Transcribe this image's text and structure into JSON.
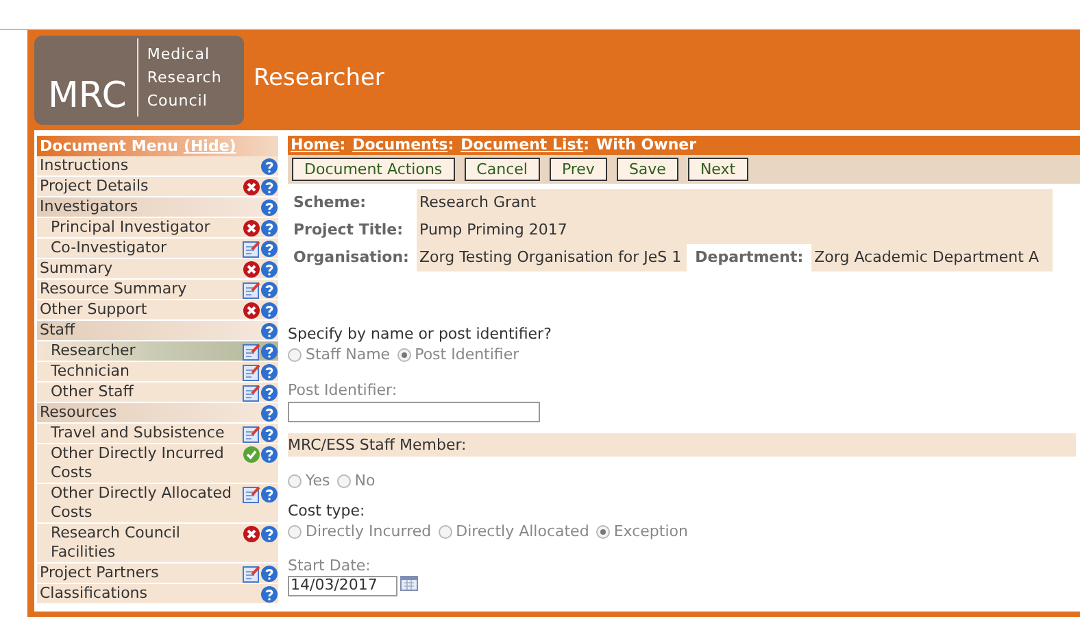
{
  "header": {
    "logo": {
      "mark": "MRC",
      "lines": [
        "Medical",
        "Research",
        "Council"
      ]
    },
    "title": "Researcher"
  },
  "menu": {
    "title": "Document Menu",
    "hide_link": "(Hide)",
    "items": [
      {
        "label": "Instructions",
        "kind": "plain",
        "selected": false
      },
      {
        "label": "Project Details",
        "kind": "error",
        "selected": false
      },
      {
        "label": "Investigators",
        "kind": "plain",
        "selected": false,
        "children": [
          {
            "label": "Principal Investigator",
            "kind": "error",
            "selected": false
          },
          {
            "label": "Co-Investigator",
            "kind": "edit",
            "selected": false
          }
        ]
      },
      {
        "label": "Summary",
        "kind": "error",
        "selected": false
      },
      {
        "label": "Resource Summary",
        "kind": "edit",
        "selected": false
      },
      {
        "label": "Other Support",
        "kind": "error",
        "selected": false
      },
      {
        "label": "Staff",
        "kind": "plain",
        "selected": false,
        "children": [
          {
            "label": "Researcher",
            "kind": "edit",
            "selected": true
          },
          {
            "label": "Technician",
            "kind": "edit",
            "selected": false
          },
          {
            "label": "Other Staff",
            "kind": "edit",
            "selected": false
          }
        ]
      },
      {
        "label": "Resources",
        "kind": "plain",
        "selected": false,
        "children": [
          {
            "label": "Travel and Subsistence",
            "kind": "edit",
            "selected": false
          },
          {
            "label": "Other Directly Incurred Costs",
            "kind": "ok",
            "selected": false
          },
          {
            "label": "Other Directly Allocated Costs",
            "kind": "edit",
            "selected": false
          },
          {
            "label": "Research Council Facilities",
            "kind": "error",
            "selected": false
          }
        ]
      },
      {
        "label": "Project Partners",
        "kind": "edit",
        "selected": false
      },
      {
        "label": "Classifications",
        "kind": "plain",
        "selected": false
      }
    ]
  },
  "breadcrumb": {
    "links": [
      "Home",
      "Documents",
      "Document List"
    ],
    "separator": ":",
    "current": "With Owner"
  },
  "toolbar": [
    "Document Actions",
    "Cancel",
    "Prev",
    "Save",
    "Next"
  ],
  "summary": {
    "scheme_label": "Scheme:",
    "scheme": "Research Grant",
    "title_label": "Project Title:",
    "title": "Pump Priming 2017",
    "org_label": "Organisation:",
    "org": "Zorg Testing Organisation for JeS 1",
    "dept_label": "Department:",
    "dept": "Zorg Academic Department A"
  },
  "form": [
    {
      "kind": "radios",
      "label": "Specify by name or post identifier?",
      "options": [
        {
          "label": "Staff Name",
          "selected": false
        },
        {
          "label": "Post Identifier",
          "selected": true
        }
      ]
    },
    {
      "kind": "text",
      "label": "Post Identifier:"
    },
    {
      "kind": "section",
      "label": "MRC/ESS Staff Member:"
    },
    {
      "kind": "radios",
      "options": [
        {
          "label": "Yes",
          "selected": false
        },
        {
          "label": "No",
          "selected": false
        }
      ]
    },
    {
      "kind": "radios",
      "label": "Cost type:",
      "options": [
        {
          "label": "Directly Incurred",
          "selected": false
        },
        {
          "label": "Directly Allocated",
          "selected": false
        },
        {
          "label": "Exception",
          "selected": true
        }
      ]
    },
    {
      "kind": "date",
      "label": "Start Date:",
      "value": "14/03/2017"
    }
  ]
}
